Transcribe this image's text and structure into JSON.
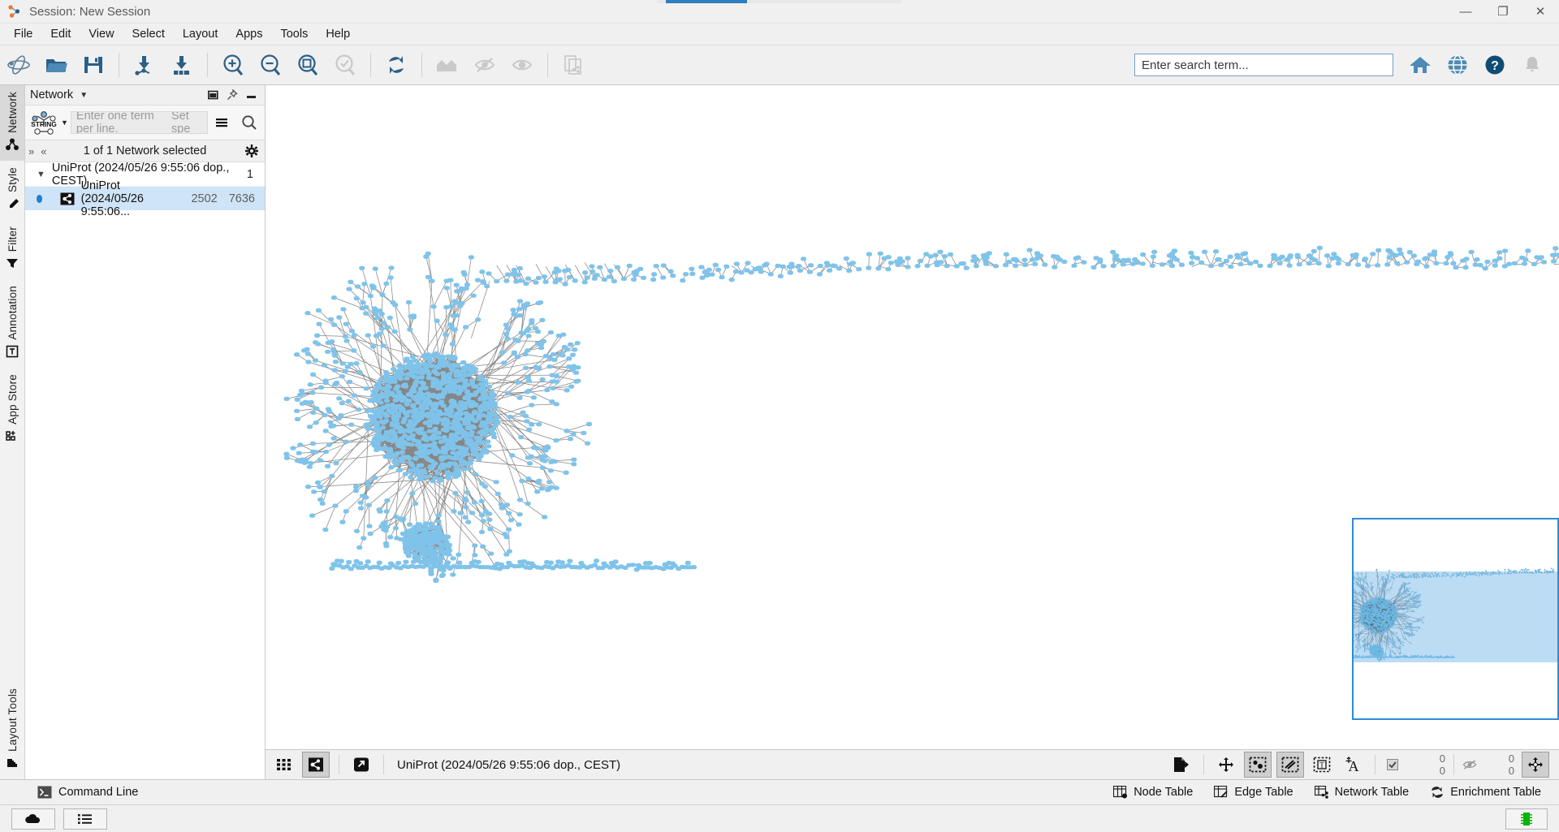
{
  "window": {
    "title": "Session: New Session",
    "app_icon": "cytoscape-icon",
    "minimize": "—",
    "maximize": "❐",
    "close": "✕"
  },
  "menubar": {
    "items": [
      "File",
      "Edit",
      "View",
      "Select",
      "Layout",
      "Apps",
      "Tools",
      "Help"
    ]
  },
  "toolbar": {
    "buttons": [
      {
        "name": "new-network-icon",
        "title": "New Network"
      },
      {
        "name": "open-folder-icon",
        "title": "Open"
      },
      {
        "name": "save-icon",
        "title": "Save"
      },
      {
        "name": "import-network-icon",
        "title": "Import Network From File"
      },
      {
        "name": "import-table-icon",
        "title": "Import Table From File"
      },
      {
        "name": "zoom-in-icon",
        "title": "Zoom In"
      },
      {
        "name": "zoom-out-icon",
        "title": "Zoom Out"
      },
      {
        "name": "zoom-fit-icon",
        "title": "Zoom Out to Display All"
      },
      {
        "name": "zoom-selected-icon",
        "title": "Fit Selected"
      },
      {
        "name": "refresh-icon",
        "title": "Refresh"
      },
      {
        "name": "hide-all-icon",
        "title": "Hide Selected"
      },
      {
        "name": "hide-unselected-icon",
        "title": "Hide Unselected"
      },
      {
        "name": "show-all-icon",
        "title": "Show All"
      },
      {
        "name": "clone-network-icon",
        "title": "Clone Network"
      }
    ],
    "right_buttons": [
      {
        "name": "home-icon",
        "title": "Home"
      },
      {
        "name": "globe-icon",
        "title": "Web"
      },
      {
        "name": "help-icon",
        "title": "Help"
      },
      {
        "name": "bell-icon",
        "title": "Notifications"
      }
    ]
  },
  "search": {
    "placeholder": "Enter search term...",
    "value": ""
  },
  "rail": {
    "tabs": [
      {
        "label": "Network",
        "icon": "network-icon",
        "active": true
      },
      {
        "label": "Style",
        "icon": "brush-icon",
        "active": false
      },
      {
        "label": "Filter",
        "icon": "funnel-icon",
        "active": false
      },
      {
        "label": "Annotation",
        "icon": "text-box-icon",
        "active": false
      },
      {
        "label": "App Store",
        "icon": "app-store-icon",
        "active": false
      }
    ],
    "bottom_tab": {
      "label": "Layout Tools",
      "icon": "ruler-icon"
    }
  },
  "control_panel": {
    "header": {
      "title": "Network",
      "dropdown_caret": "▼",
      "float_icon": "float-window-icon",
      "pin_icon": "pin-icon",
      "minimize_icon": "minimize-icon"
    },
    "string_bar": {
      "logo": "STRING",
      "caret": "▼",
      "placeholder": "Enter one term per line.",
      "secondary_placeholder": "Set spe",
      "options_icon": "hamburger-icon",
      "search_icon": "search-icon"
    },
    "selection_bar": {
      "collapse_all_icon": "»",
      "expand_all_icon": "«",
      "text": "1 of 1 Network selected",
      "settings_icon": "gear-icon"
    },
    "networks": [
      {
        "name": "UniProt (2024/05/26 9:55:06 dop., CEST)",
        "count": "1",
        "expanded": true,
        "views": [
          {
            "name": "UniProt (2024/05/26 9:55:06...",
            "nodes": "2502",
            "edges": "7636",
            "selected": true
          }
        ]
      }
    ]
  },
  "view_toolbar": {
    "grid_icon": "grid-view-icon",
    "network_icon": "network-view-icon",
    "detach_icon": "detach-view-icon",
    "title": "UniProt (2024/05/26 9:55:06 dop., CEST)",
    "right_buttons": [
      {
        "name": "export-image-icon",
        "active": false
      },
      {
        "name": "move-nodes-icon",
        "active": false
      },
      {
        "name": "select-nodes-icon",
        "active": true
      },
      {
        "name": "select-edges-icon",
        "active": true
      },
      {
        "name": "select-annotations-icon",
        "active": false
      },
      {
        "name": "select-labels-icon",
        "active": false
      }
    ],
    "counts": {
      "selected_icon": "checkbox-checked-icon",
      "selected_nodes": "0",
      "selected_edges": "0",
      "hidden_icon": "hidden-eye-icon",
      "hidden_nodes": "0",
      "hidden_edges": "0"
    },
    "birdseye_toggle": {
      "name": "birdseye-toggle-icon",
      "active": true
    }
  },
  "table_bar": {
    "command_line": {
      "icon": "terminal-icon",
      "label": "Command Line"
    },
    "links": [
      {
        "label": "Node Table",
        "icon": "node-table-icon"
      },
      {
        "label": "Edge Table",
        "icon": "edge-table-icon"
      },
      {
        "label": "Network Table",
        "icon": "network-table-icon"
      },
      {
        "label": "Enrichment Table",
        "icon": "enrichment-table-icon"
      }
    ]
  },
  "status_bar": {
    "buttons": [
      {
        "name": "cloud-icon"
      },
      {
        "name": "list-icon"
      }
    ],
    "memory_icon": "memory-icon"
  },
  "colors": {
    "accent": "#2e8bd6",
    "node_fill": "#7fc3ea",
    "edge": "#7a7a7a",
    "panel_bg": "#f0f0f0",
    "selection_bg": "#cfe4f7",
    "toolbar_icon": "#2b5f87",
    "birdseye_view": "#bcdcf4"
  },
  "graph": {
    "node_count": "2502",
    "edge_count": "7636"
  }
}
